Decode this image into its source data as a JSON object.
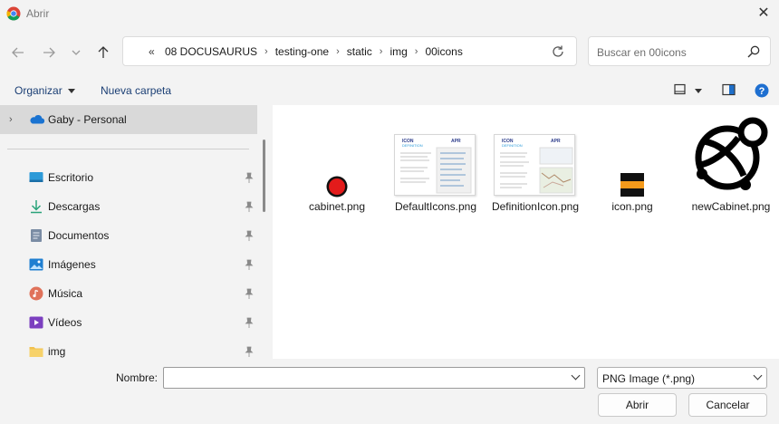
{
  "window": {
    "title": "Abrir"
  },
  "address": {
    "overflow_marker": "«",
    "crumbs": [
      "08 DOCUSAURUS",
      "testing-one",
      "static",
      "img",
      "00icons"
    ]
  },
  "search": {
    "placeholder": "Buscar en 00icons"
  },
  "toolbar": {
    "organize_label": "Organizar",
    "new_folder_label": "Nueva carpeta"
  },
  "sidebar": {
    "onedrive_label": "Gaby - Personal",
    "quick_access": [
      {
        "label": "Escritorio",
        "icon": "desktop-icon"
      },
      {
        "label": "Descargas",
        "icon": "download-icon"
      },
      {
        "label": "Documentos",
        "icon": "documents-icon"
      },
      {
        "label": "Imágenes",
        "icon": "pictures-icon"
      },
      {
        "label": "Música",
        "icon": "music-icon"
      },
      {
        "label": "Vídeos",
        "icon": "videos-icon"
      },
      {
        "label": "img",
        "icon": "folder-icon"
      }
    ]
  },
  "files": [
    {
      "name": "cabinet.png"
    },
    {
      "name": "DefaultIcons.png"
    },
    {
      "name": "DefinitionIcon.png"
    },
    {
      "name": "icon.png"
    },
    {
      "name": "newCabinet.png"
    }
  ],
  "footer": {
    "filename_label": "Nombre:",
    "filename_value": "",
    "file_type": "PNG Image (*.png)",
    "open_label": "Abrir",
    "cancel_label": "Cancelar"
  },
  "colors": {
    "accent": "#0078d4",
    "link": "#1a3e74",
    "selection": "#d9d9d9"
  }
}
